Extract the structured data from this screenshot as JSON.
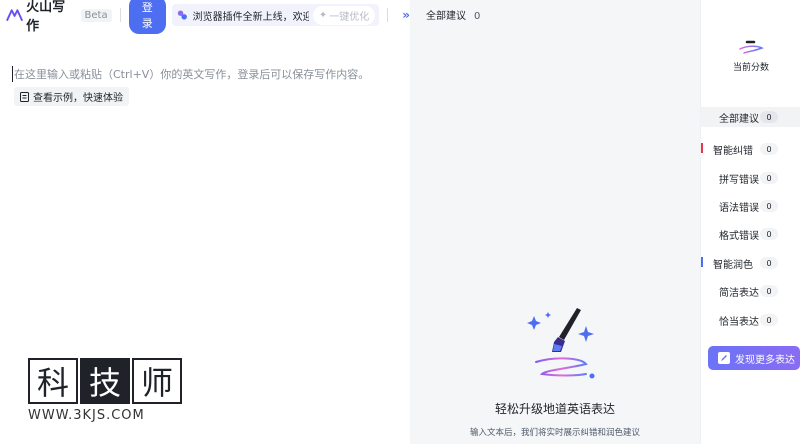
{
  "app": {
    "name": "火山写作",
    "badge": "Beta"
  },
  "header": {
    "login_label": "登录",
    "notice_text": "浏览器插件全新上线，欢迎安装使用",
    "optimize_label": "一键优化",
    "collapse_glyph": "»"
  },
  "editor": {
    "placeholder": "在这里输入或粘贴（Ctrl+V）你的英文写作，登录后可以保存写作内容。",
    "example_label": "查看示例，快速体验"
  },
  "watermark": {
    "chars": [
      "科",
      "技",
      "师"
    ],
    "url": "WWW.3KJS.COM"
  },
  "suggestions": {
    "title": "全部建议",
    "count": "0",
    "empty_heading": "轻松升级地道英语表达",
    "empty_sub": "输入文本后，我们将实时展示纠错和润色建议"
  },
  "sidebar": {
    "score_label": "当前分数",
    "items": [
      {
        "label": "全部建议",
        "count": "0"
      },
      {
        "label": "智能纠错",
        "count": "0"
      },
      {
        "label": "拼写错误",
        "count": "0"
      },
      {
        "label": "语法错误",
        "count": "0"
      },
      {
        "label": "格式错误",
        "count": "0"
      },
      {
        "label": "智能润色",
        "count": "0"
      },
      {
        "label": "简洁表达",
        "count": "0"
      },
      {
        "label": "恰当表达",
        "count": "0"
      }
    ],
    "discover_label": "发现更多表达"
  },
  "colors": {
    "accent": "#4e6ef2",
    "error_bar": "#e5394a",
    "polish_bar": "#4e6ef2"
  }
}
